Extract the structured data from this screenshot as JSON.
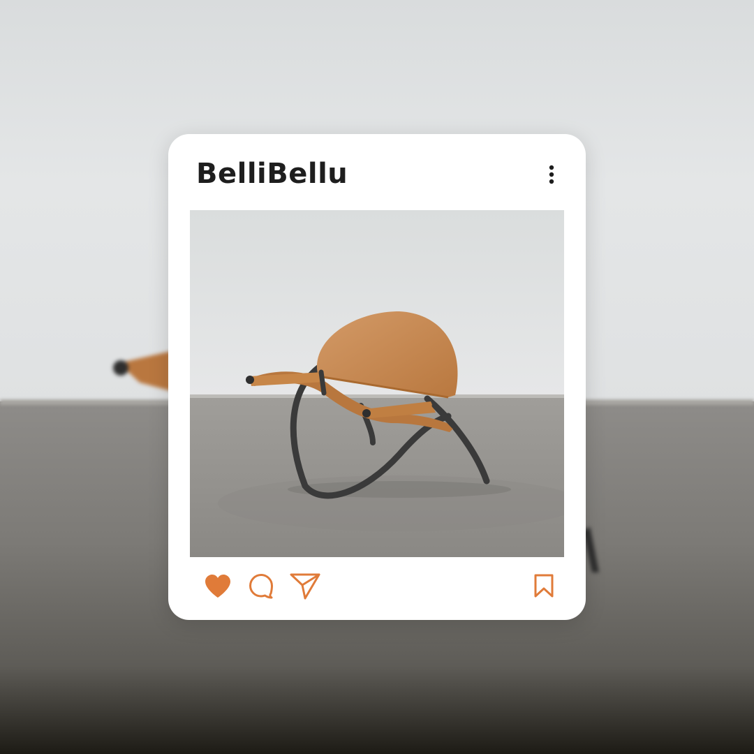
{
  "post": {
    "username": "BelliBellu",
    "image_alt": "",
    "liked": true
  },
  "colors": {
    "accent": "#e07b39",
    "text": "#1e1e1e",
    "card": "#ffffff",
    "leather": "#c98b55",
    "frame": "#3a3a3a"
  },
  "icons": {
    "more": "vertical-ellipsis-icon",
    "like": "heart-icon",
    "comment": "speech-bubble-icon",
    "share": "paper-plane-icon",
    "save": "bookmark-icon"
  }
}
